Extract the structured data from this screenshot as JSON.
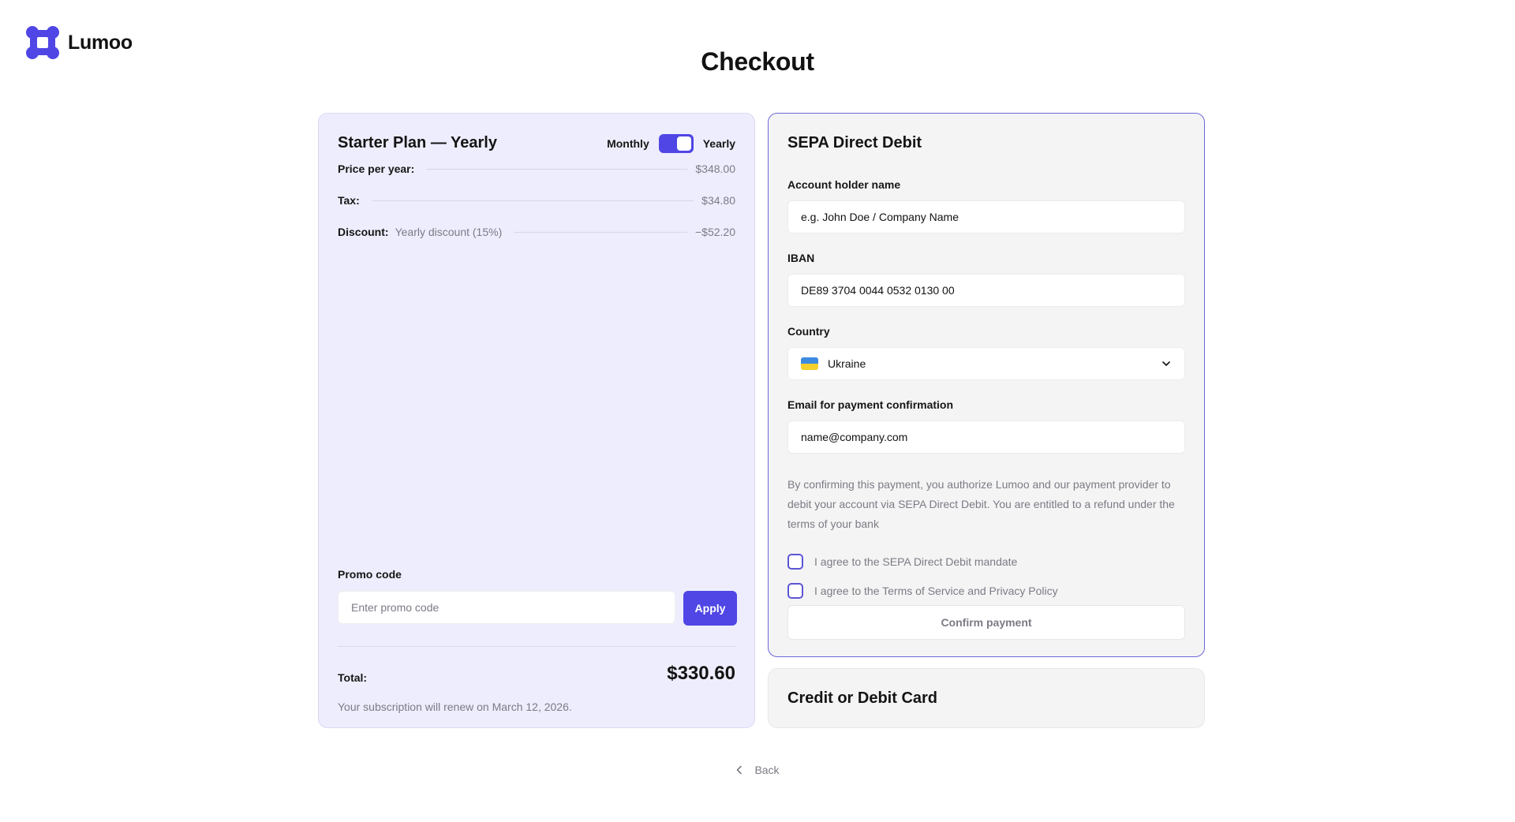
{
  "brand": {
    "name": "Lumoo",
    "color": "#4f46e5"
  },
  "page": {
    "title": "Checkout"
  },
  "summary": {
    "plan_title": "Starter Plan — Yearly",
    "toggle": {
      "left_label": "Monthly",
      "right_label": "Yearly",
      "selected": "Yearly"
    },
    "lines": [
      {
        "label": "Price per year:",
        "sub": "",
        "value": "$348.00"
      },
      {
        "label": "Tax:",
        "sub": "",
        "value": "$34.80"
      },
      {
        "label": "Discount:",
        "sub": "Yearly discount (15%)",
        "value": "−$52.20"
      }
    ],
    "promo": {
      "label": "Promo code",
      "placeholder": "Enter promo code",
      "apply_label": "Apply"
    },
    "total": {
      "label": "Total:",
      "value": "$330.60"
    },
    "renewal_note": "Your subscription will renew on March 12, 2026."
  },
  "sepa": {
    "title": "SEPA Direct Debit",
    "account_holder": {
      "label": "Account holder name",
      "placeholder": "e.g. John Doe / Company Name"
    },
    "iban": {
      "label": "IBAN",
      "placeholder": "DE89 3704 0044 0532 0130 00"
    },
    "country": {
      "label": "Country",
      "value": "Ukraine",
      "flag_colors": [
        "#3d8bdf",
        "#f5cf2b"
      ]
    },
    "email": {
      "label": "Email for payment confirmation",
      "placeholder": "name@company.com"
    },
    "consent_text": "By confirming this payment, you authorize Lumoo and our payment provider to debit your account via SEPA Direct Debit. You are entitled to a refund under the terms of your bank",
    "checkboxes": [
      {
        "label": "I agree to the SEPA Direct Debit mandate",
        "checked": false
      },
      {
        "label": "I agree to the Terms of Service and Privacy Policy",
        "checked": false
      }
    ],
    "confirm_label": "Confirm payment"
  },
  "card_option": {
    "title": "Credit or Debit Card"
  },
  "back": {
    "label": "Back"
  }
}
